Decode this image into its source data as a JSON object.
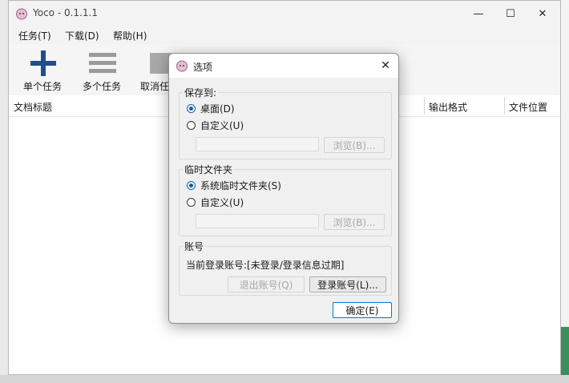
{
  "window": {
    "title": "Yoco - 0.1.1.1",
    "controls": {
      "minimize": "—",
      "maximize": "☐",
      "close": "✕"
    }
  },
  "menu": [
    {
      "label": "任务(T)"
    },
    {
      "label": "下载(D)"
    },
    {
      "label": "帮助(H)"
    }
  ],
  "toolbar": {
    "single_task": "单个任务",
    "multi_task": "多个任务",
    "cancel_task": "取消任"
  },
  "grid": {
    "columns": [
      "文档标题",
      "输出格式",
      "文件位置"
    ]
  },
  "dialog": {
    "title": "选项",
    "close": "✕",
    "save_to": {
      "label": "保存到:",
      "options": [
        {
          "label": "桌面(D)",
          "checked": true
        },
        {
          "label": "自定义(U)",
          "checked": false
        }
      ],
      "path_value": "",
      "browse": "浏览(B)..."
    },
    "temp_folder": {
      "label": "临时文件夹",
      "options": [
        {
          "label": "系统临时文件夹(S)",
          "checked": true
        },
        {
          "label": "自定义(U)",
          "checked": false
        }
      ],
      "path_value": "",
      "browse": "浏览(B)..."
    },
    "account": {
      "label": "账号",
      "current": "当前登录账号:[未登录/登录信息过期]",
      "logout": "退出账号(Q)",
      "login": "登录账号(L)..."
    },
    "ok": "确定(E)"
  },
  "colors": {
    "accent": "#0a5fb4",
    "plus_icon": "#1f4f8a",
    "app_icon": "#d9a7c9"
  }
}
